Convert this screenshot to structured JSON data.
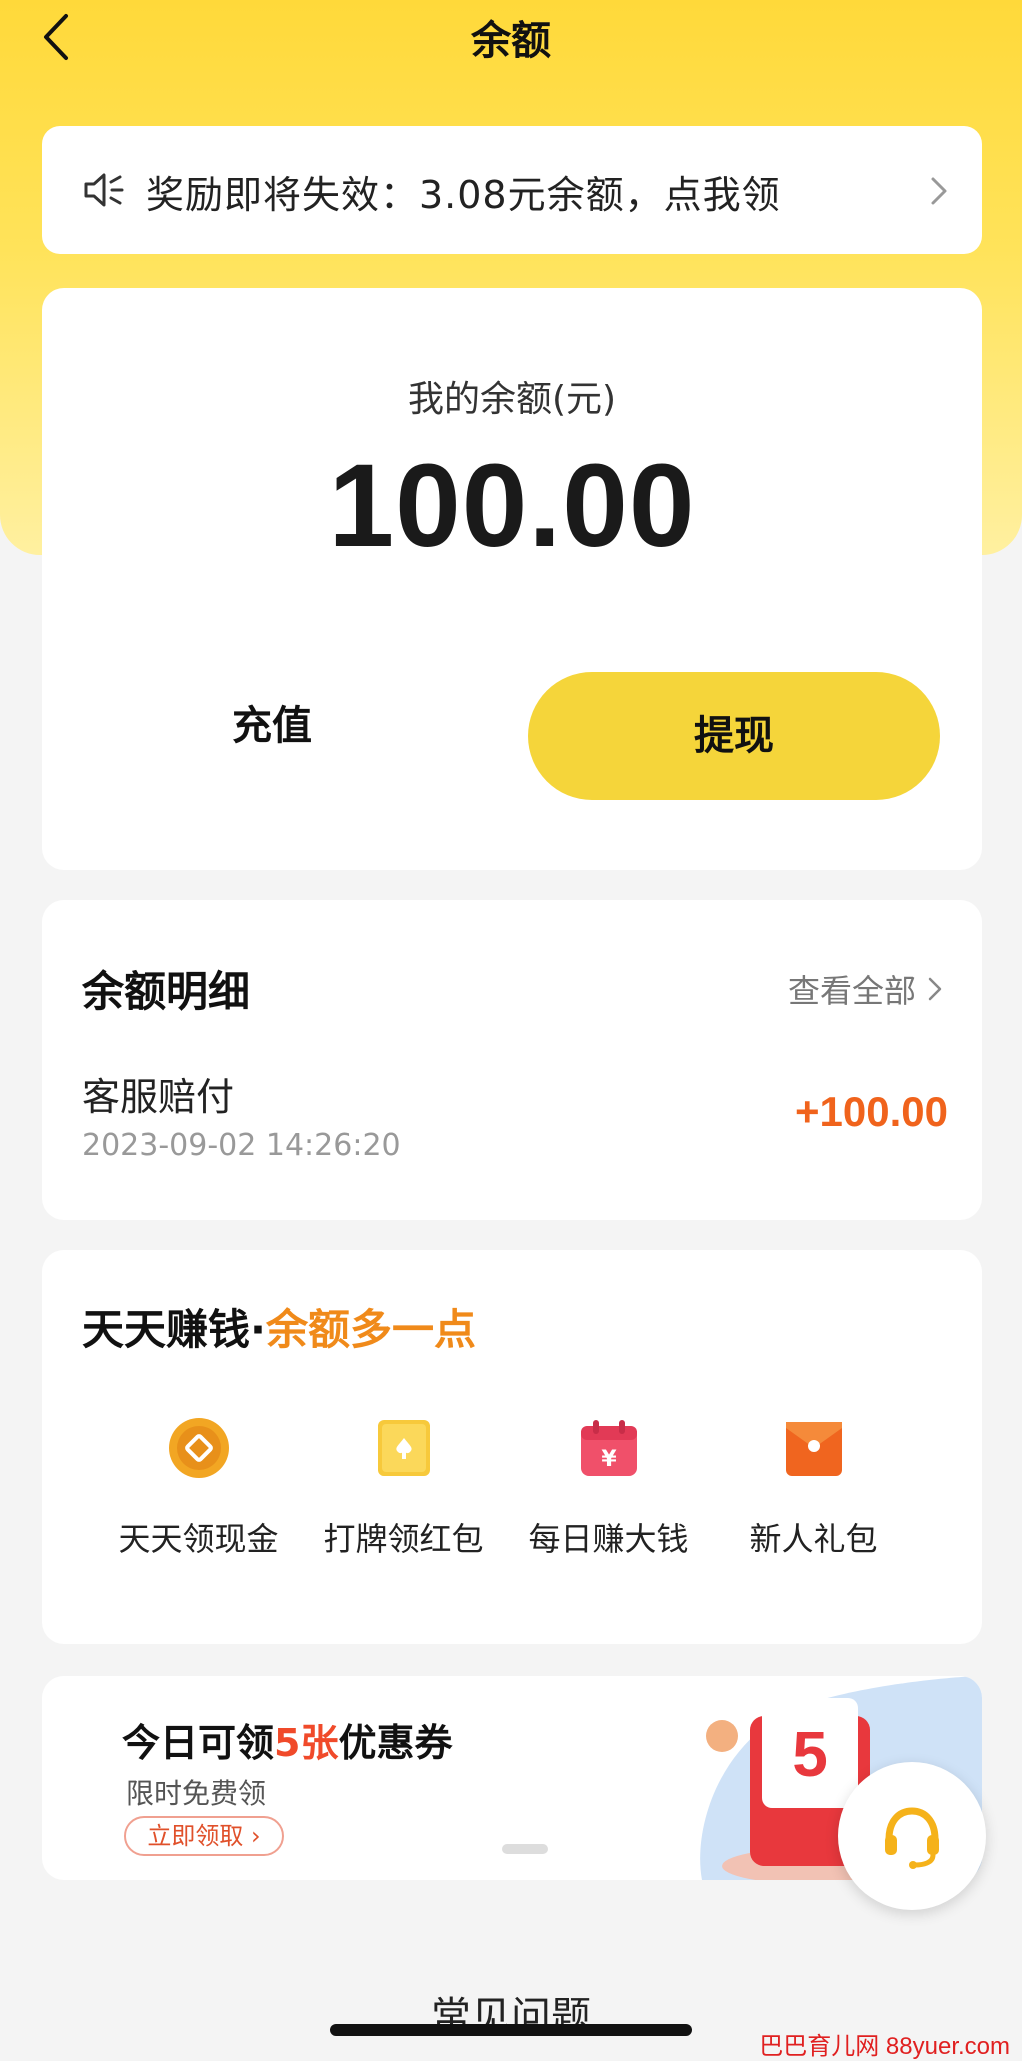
{
  "nav": {
    "title": "余额"
  },
  "notice": {
    "text": "奖励即将失效：3.08元余额，点我领"
  },
  "balance": {
    "label": "我的余额(元)",
    "amount": "100.00",
    "recharge_label": "充值",
    "withdraw_label": "提现",
    "accent_color": "#f5d53a"
  },
  "details": {
    "title": "余额明细",
    "view_all": "查看全部",
    "transactions": [
      {
        "name": "客服赔付",
        "time": "2023-09-02 14:26:20",
        "amount": "+100.00"
      }
    ]
  },
  "earn": {
    "title_prefix": "天天赚钱·",
    "title_accent": "余额多一点",
    "items": [
      {
        "label": "天天领现金",
        "icon": "gold-coin-icon"
      },
      {
        "label": "打牌领红包",
        "icon": "yellow-card-icon"
      },
      {
        "label": "每日赚大钱",
        "icon": "calendar-money-icon"
      },
      {
        "label": "新人礼包",
        "icon": "gift-envelope-icon"
      }
    ]
  },
  "promo": {
    "title_prefix": "今日可领",
    "title_highlight": "5张",
    "title_suffix": "优惠券",
    "subtitle": "限时免费领",
    "button": "立即领取",
    "art_number": "5"
  },
  "faq": {
    "title": "常见问题"
  },
  "watermark": "巴巴育儿网 88yuer.com"
}
